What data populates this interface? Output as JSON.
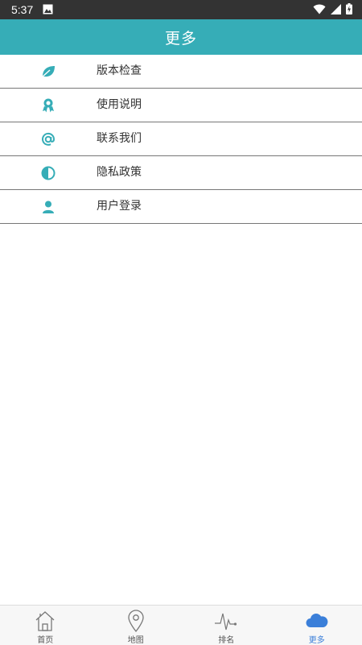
{
  "status": {
    "time": "5:37"
  },
  "header": {
    "title": "更多"
  },
  "menu": {
    "items": [
      {
        "label": "版本检查",
        "icon": "leaf-icon"
      },
      {
        "label": "使用说明",
        "icon": "award-icon"
      },
      {
        "label": "联系我们",
        "icon": "at-icon"
      },
      {
        "label": "隐私政策",
        "icon": "half-circle-icon"
      },
      {
        "label": "用户登录",
        "icon": "user-icon"
      }
    ]
  },
  "nav": {
    "items": [
      {
        "label": "首页",
        "icon": "home-icon"
      },
      {
        "label": "地图",
        "icon": "map-pin-icon"
      },
      {
        "label": "排名",
        "icon": "pulse-icon"
      },
      {
        "label": "更多",
        "icon": "cloud-icon",
        "active": true
      }
    ]
  },
  "colors": {
    "accent": "#36adb7",
    "active_tab": "#3b7fd9",
    "status_bar": "#333333"
  }
}
